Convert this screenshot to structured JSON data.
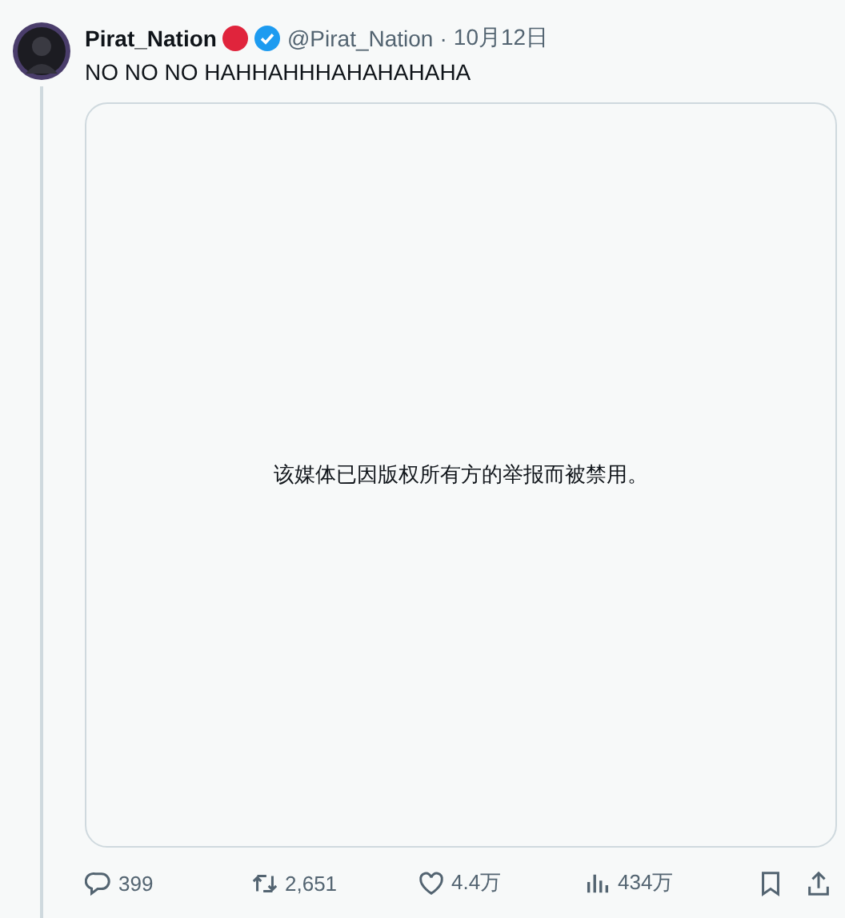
{
  "tweet": {
    "display_name": "Pirat_Nation",
    "verified": true,
    "handle": "@Pirat_Nation",
    "separator": "·",
    "date": "10月12日",
    "text": "NO NO NO HAHHAHHHAHAHAHAHA",
    "media": {
      "notice": "该媒体已因版权所有方的举报而被禁用。"
    },
    "actions": [
      {
        "kind": "reply",
        "count": "399"
      },
      {
        "kind": "retweet",
        "count": "2,651"
      },
      {
        "kind": "like",
        "count": "4.4万"
      },
      {
        "kind": "views",
        "count": "434万"
      },
      {
        "kind": "bookmark"
      },
      {
        "kind": "share"
      }
    ]
  }
}
